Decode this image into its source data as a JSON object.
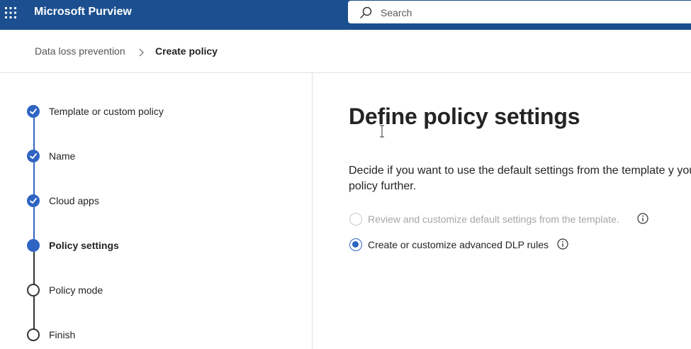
{
  "app": {
    "title": "Microsoft Purview"
  },
  "search": {
    "placeholder": "Search"
  },
  "breadcrumb": {
    "parent": "Data loss prevention",
    "current": "Create policy"
  },
  "wizard": {
    "steps": [
      {
        "label": "Template or custom policy",
        "state": "completed"
      },
      {
        "label": "Name",
        "state": "completed"
      },
      {
        "label": "Cloud apps",
        "state": "completed"
      },
      {
        "label": "Policy settings",
        "state": "current"
      },
      {
        "label": "Policy mode",
        "state": "pending"
      },
      {
        "label": "Finish",
        "state": "pending"
      }
    ]
  },
  "main": {
    "heading": "Define policy settings",
    "description": "Decide if you want to use the default settings from the template y your policy further.",
    "options": [
      {
        "label": "Review and customize default settings from the template.",
        "selected": false,
        "disabled": true
      },
      {
        "label": "Create or customize advanced DLP rules",
        "selected": true,
        "disabled": false
      }
    ]
  },
  "colors": {
    "topbar": "#1b4f8f",
    "accent": "#2f64c2"
  },
  "icons": {
    "app_launcher": "waffle-icon",
    "search": "search-icon",
    "chevron": "chevron-right-icon",
    "info": "info-icon",
    "check": "checkmark-icon"
  }
}
